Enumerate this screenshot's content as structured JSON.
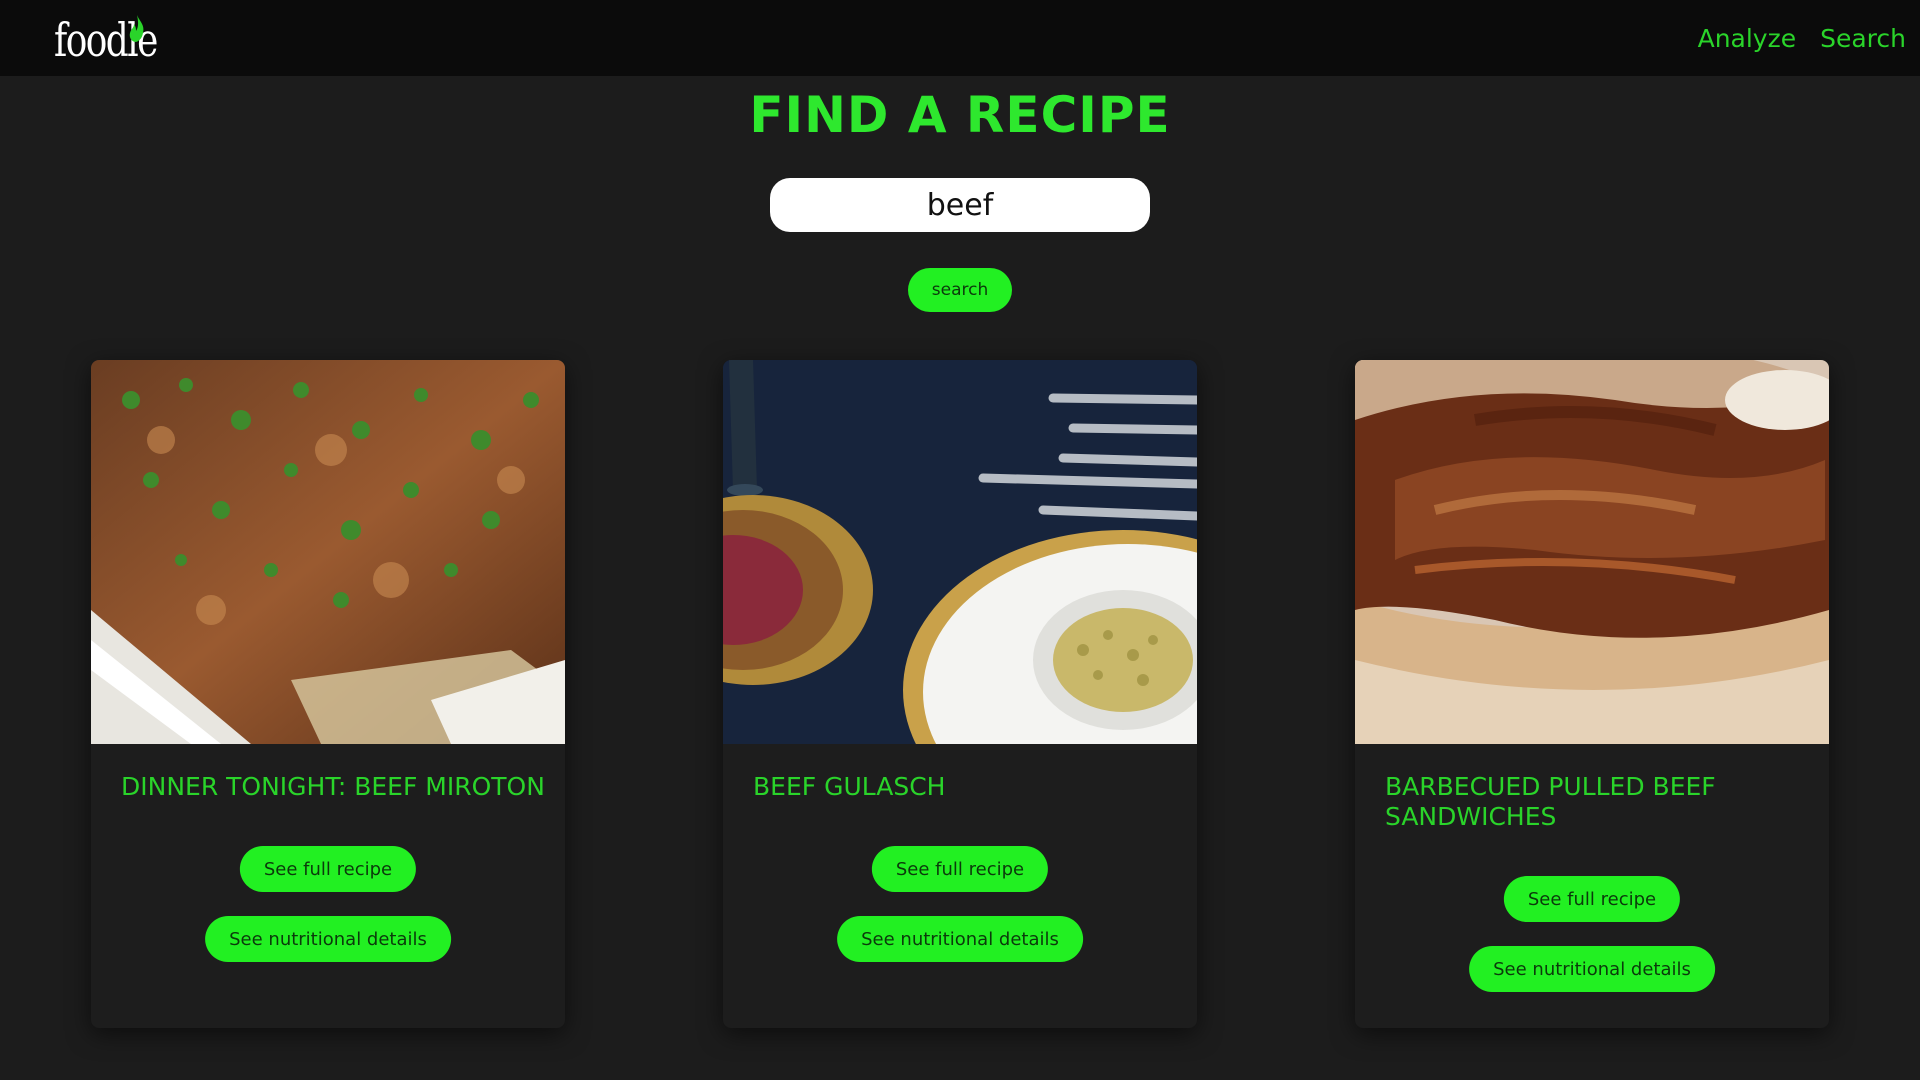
{
  "nav": {
    "logo": "foodle",
    "links": [
      "Analyze",
      "Search"
    ]
  },
  "page": {
    "title": "FIND A RECIPE"
  },
  "search": {
    "value": "beef",
    "button_label": "search"
  },
  "cards": [
    {
      "title": "DINNER TONIGHT: BEEF MIROTON",
      "full_recipe_label": "See full recipe",
      "nutrition_label": "See nutritional details"
    },
    {
      "title": "BEEF GULASCH",
      "full_recipe_label": "See full recipe",
      "nutrition_label": "See nutritional details"
    },
    {
      "title": "BARBECUED PULLED BEEF SANDWICHES",
      "full_recipe_label": "See full recipe",
      "nutrition_label": "See nutritional details"
    }
  ],
  "colors": {
    "accent": "#22f022",
    "title_green": "#2ee82e",
    "background": "#1c1c1c",
    "navbar": "#0b0b0b"
  }
}
